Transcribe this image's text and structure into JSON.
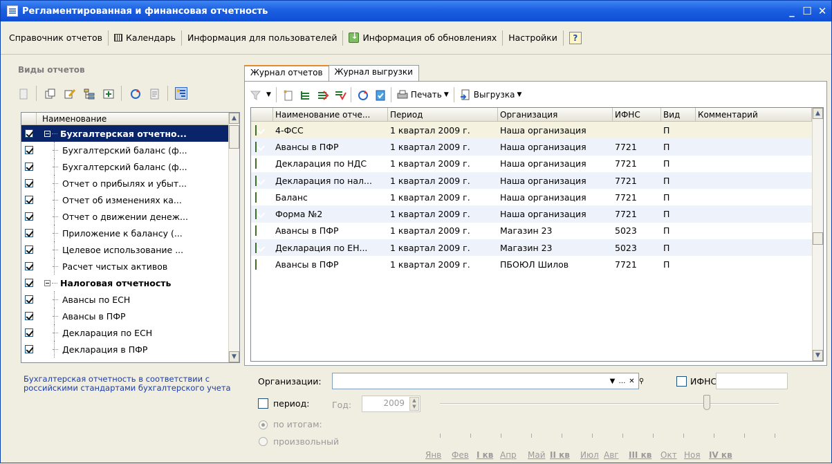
{
  "window": {
    "title": "Регламентированная и финансовая отчетность"
  },
  "menu": {
    "items": [
      "Справочник отчетов",
      "Календарь",
      "Информация для пользователей",
      "Информация об обновлениях",
      "Настройки"
    ]
  },
  "left": {
    "title": "Виды отчетов",
    "column_header": "Наименование",
    "tree": [
      {
        "label": "Бухгалтерская отчетно...",
        "group": true,
        "checked": true,
        "selected": true
      },
      {
        "label": "Бухгалтерский баланс (ф...",
        "checked": true
      },
      {
        "label": "Бухгалтерский баланс (ф...",
        "checked": true
      },
      {
        "label": "Отчет о прибылях и убыт...",
        "checked": true
      },
      {
        "label": "Отчет об изменениях ка...",
        "checked": true
      },
      {
        "label": "Отчет о движении денеж...",
        "checked": true
      },
      {
        "label": "Приложение к балансу (...",
        "checked": true
      },
      {
        "label": "Целевое использование ...",
        "checked": true
      },
      {
        "label": "Расчет чистых активов",
        "checked": true
      },
      {
        "label": "Налоговая отчетность",
        "group": true,
        "checked": true
      },
      {
        "label": "Авансы по ЕСН",
        "checked": true
      },
      {
        "label": "Авансы в ПФР",
        "checked": true
      },
      {
        "label": "Декларация по ЕСН",
        "checked": true
      },
      {
        "label": "Декларация в ПФР",
        "checked": true
      }
    ],
    "description": "Бухгалтерская отчетность в соответствии с российскими стандартами бухгалтерского учета"
  },
  "tabs": [
    {
      "label": "Журнал отчетов",
      "active": true
    },
    {
      "label": "Журнал выгрузки",
      "active": false
    }
  ],
  "toolbar": {
    "print_label": "Печать",
    "export_label": "Выгрузка"
  },
  "grid": {
    "headers": [
      "Наименование отче...",
      "Период",
      "Организация",
      "ИФНС",
      "Вид",
      "Комментарий"
    ],
    "rows": [
      {
        "name": "4-ФСС",
        "period": "1 квартал 2009 г.",
        "org": "Наша организация",
        "ifns": "",
        "kind": "П",
        "comment": ""
      },
      {
        "name": "Авансы в ПФР",
        "period": "1 квартал 2009 г.",
        "org": "Наша организация",
        "ifns": "7721",
        "kind": "П",
        "comment": ""
      },
      {
        "name": "Декларация по НДС",
        "period": "1 квартал 2009 г.",
        "org": "Наша организация",
        "ifns": "7721",
        "kind": "П",
        "comment": ""
      },
      {
        "name": "Декларация по нал...",
        "period": "1 квартал 2009 г.",
        "org": "Наша организация",
        "ifns": "7721",
        "kind": "П",
        "comment": ""
      },
      {
        "name": "Баланс",
        "period": "1 квартал 2009 г.",
        "org": "Наша организация",
        "ifns": "7721",
        "kind": "П",
        "comment": ""
      },
      {
        "name": "Форма №2",
        "period": "1 квартал 2009 г.",
        "org": "Наша организация",
        "ifns": "7721",
        "kind": "П",
        "comment": ""
      },
      {
        "name": "Авансы в ПФР",
        "period": "1 квартал 2009 г.",
        "org": "Магазин 23",
        "ifns": "5023",
        "kind": "П",
        "comment": ""
      },
      {
        "name": "Декларация по ЕН...",
        "period": "1 квартал 2009 г.",
        "org": "Магазин 23",
        "ifns": "5023",
        "kind": "П",
        "comment": ""
      },
      {
        "name": "Авансы в ПФР",
        "period": "1 квартал 2009 г.",
        "org": "ПБОЮЛ  Шилов",
        "ifns": "7721",
        "kind": "П",
        "comment": ""
      }
    ]
  },
  "filter": {
    "org_label": "Организации:",
    "org_value": "",
    "ifns_label": "ИФНС:",
    "ifns_value": "",
    "period_label": "период:",
    "year_label": "Год:",
    "year_value": "2009",
    "radio_totals": "по итогам:",
    "radio_custom": "произвольный",
    "months": [
      "Янв",
      "Фев",
      "I кв",
      "Апр",
      "Май",
      "II кв",
      "Июл",
      "Авг",
      "III кв",
      "Окт",
      "Ноя",
      "IV кв"
    ]
  }
}
